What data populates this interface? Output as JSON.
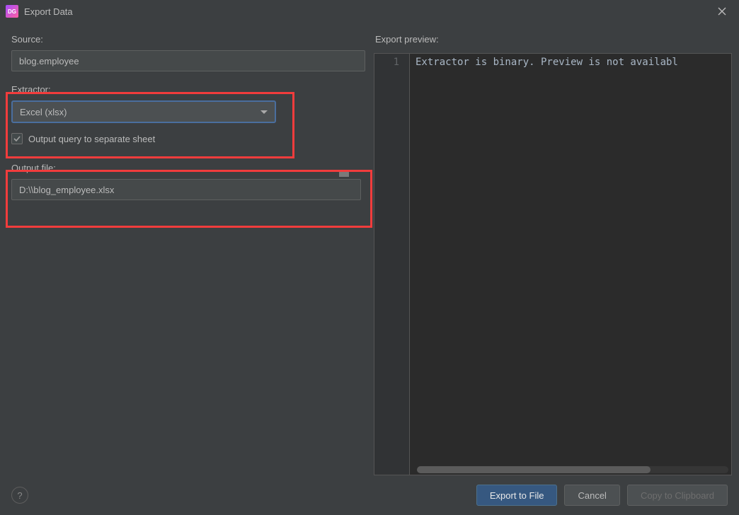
{
  "titlebar": {
    "app_icon_text": "DG",
    "title": "Export Data"
  },
  "left": {
    "source_label": "Source:",
    "source_value": "blog.employee",
    "extractor_label": "Extractor:",
    "extractor_value": "Excel (xlsx)",
    "output_query_checkbox_label": "Output query to separate sheet",
    "output_query_checked": true,
    "output_file_label": "Output file:",
    "output_file_value": "D:\\\\blog_employee.xlsx"
  },
  "right": {
    "preview_label": "Export preview:",
    "gutter_line": "1",
    "preview_text": "Extractor is binary. Preview is not availabl"
  },
  "footer": {
    "help_tooltip": "?",
    "export_button": "Export to File",
    "cancel_button": "Cancel",
    "copy_button": "Copy to Clipboard"
  }
}
